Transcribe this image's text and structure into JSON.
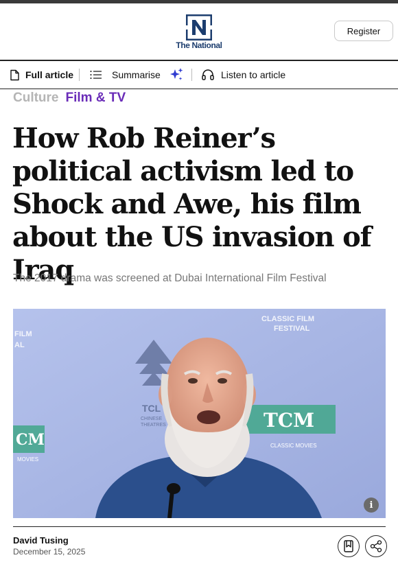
{
  "header": {
    "logo_text": "The National",
    "register_label": "Register"
  },
  "toolbar": {
    "full_article_label": "Full article",
    "summarise_label": "Summarise",
    "listen_label": "Listen to article"
  },
  "breadcrumb": {
    "section": "Culture",
    "subsection": "Film & TV"
  },
  "article": {
    "headline": "How Rob Reiner’s political activism led to Shock and Awe, his film about the US invasion of Iraq",
    "subheadline": "The 2017 drama was screened at Dubai International Film Festival",
    "image_info_label": "i",
    "author": "David Tusing",
    "date": "December 15, 2025"
  },
  "photo_backdrop": {
    "top_right_text_1": "CLASSIC FILM",
    "top_right_text_2": "FESTIVAL",
    "top_left_text_1": "FILM",
    "top_left_text_2": "AL",
    "tcm_right": "TCM",
    "tcm_right_sub": "CLASSIC MOVIES",
    "tcm_left": "CM",
    "tcm_left_sub": "MOVIES",
    "tcl_text": "TCL",
    "tcl_sub": "CHINESE",
    "tcl_sub2": "THEATRES"
  },
  "colors": {
    "accent_purple": "#6a2cb8",
    "logo_blue": "#1c3d6e",
    "photo_backdrop": "#a9b7e6"
  },
  "icons": [
    "document-icon",
    "list-icon",
    "sparkle-icon",
    "headphones-icon",
    "info-icon",
    "bookmark-icon",
    "share-icon"
  ]
}
